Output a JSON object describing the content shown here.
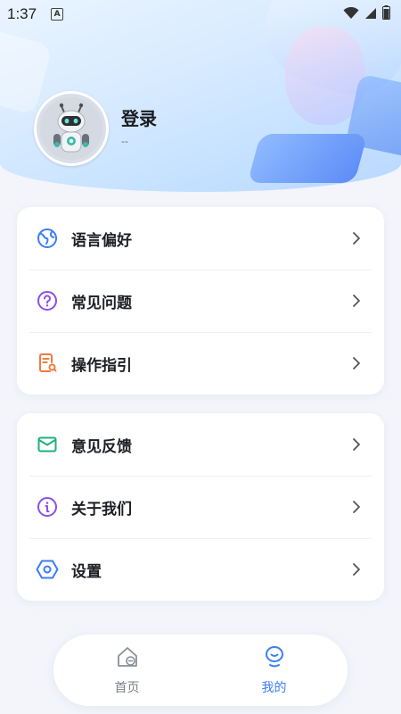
{
  "status_bar": {
    "time": "1:37",
    "notification_badge": "A",
    "icons": [
      "wifi-icon",
      "signal-icon",
      "battery-icon"
    ]
  },
  "profile": {
    "login_label": "登录",
    "sub_text": "--",
    "avatar": "robot-avatar"
  },
  "menu_group_1": [
    {
      "label": "语言偏好",
      "icon": "globe-icon",
      "color": "#3b7df3"
    },
    {
      "label": "常见问题",
      "icon": "question-icon",
      "color": "#8b4fe8"
    },
    {
      "label": "操作指引",
      "icon": "guide-document-icon",
      "color": "#f07a3c"
    }
  ],
  "menu_group_2": [
    {
      "label": "意见反馈",
      "icon": "mail-icon",
      "color": "#20b07a"
    },
    {
      "label": "关于我们",
      "icon": "info-icon",
      "color": "#8b4fe8"
    },
    {
      "label": "设置",
      "icon": "settings-hexagon-icon",
      "color": "#3b7df3"
    }
  ],
  "bottom_nav": {
    "home_label": "首页",
    "mine_label": "我的",
    "active": "mine",
    "active_color": "#3a7ef4",
    "inactive_color": "#7b7f88"
  }
}
